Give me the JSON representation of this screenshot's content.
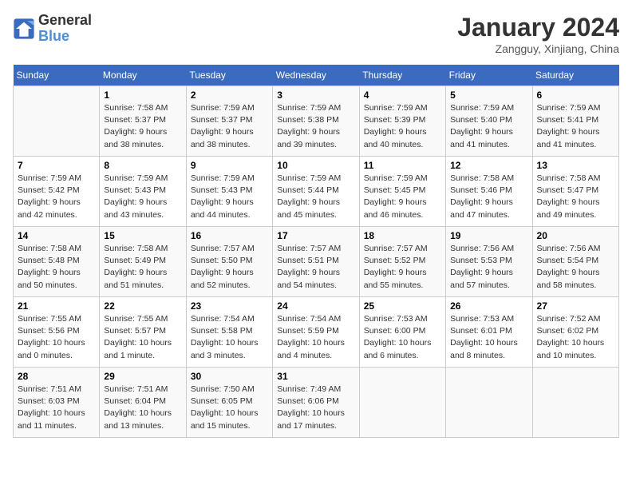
{
  "header": {
    "logo_line1": "General",
    "logo_line2": "Blue",
    "month": "January 2024",
    "location": "Zangguy, Xinjiang, China"
  },
  "weekdays": [
    "Sunday",
    "Monday",
    "Tuesday",
    "Wednesday",
    "Thursday",
    "Friday",
    "Saturday"
  ],
  "weeks": [
    [
      {
        "day": "",
        "info": ""
      },
      {
        "day": "1",
        "info": "Sunrise: 7:58 AM\nSunset: 5:37 PM\nDaylight: 9 hours\nand 38 minutes."
      },
      {
        "day": "2",
        "info": "Sunrise: 7:59 AM\nSunset: 5:37 PM\nDaylight: 9 hours\nand 38 minutes."
      },
      {
        "day": "3",
        "info": "Sunrise: 7:59 AM\nSunset: 5:38 PM\nDaylight: 9 hours\nand 39 minutes."
      },
      {
        "day": "4",
        "info": "Sunrise: 7:59 AM\nSunset: 5:39 PM\nDaylight: 9 hours\nand 40 minutes."
      },
      {
        "day": "5",
        "info": "Sunrise: 7:59 AM\nSunset: 5:40 PM\nDaylight: 9 hours\nand 41 minutes."
      },
      {
        "day": "6",
        "info": "Sunrise: 7:59 AM\nSunset: 5:41 PM\nDaylight: 9 hours\nand 41 minutes."
      }
    ],
    [
      {
        "day": "7",
        "info": "Sunrise: 7:59 AM\nSunset: 5:42 PM\nDaylight: 9 hours\nand 42 minutes."
      },
      {
        "day": "8",
        "info": "Sunrise: 7:59 AM\nSunset: 5:43 PM\nDaylight: 9 hours\nand 43 minutes."
      },
      {
        "day": "9",
        "info": "Sunrise: 7:59 AM\nSunset: 5:43 PM\nDaylight: 9 hours\nand 44 minutes."
      },
      {
        "day": "10",
        "info": "Sunrise: 7:59 AM\nSunset: 5:44 PM\nDaylight: 9 hours\nand 45 minutes."
      },
      {
        "day": "11",
        "info": "Sunrise: 7:59 AM\nSunset: 5:45 PM\nDaylight: 9 hours\nand 46 minutes."
      },
      {
        "day": "12",
        "info": "Sunrise: 7:58 AM\nSunset: 5:46 PM\nDaylight: 9 hours\nand 47 minutes."
      },
      {
        "day": "13",
        "info": "Sunrise: 7:58 AM\nSunset: 5:47 PM\nDaylight: 9 hours\nand 49 minutes."
      }
    ],
    [
      {
        "day": "14",
        "info": "Sunrise: 7:58 AM\nSunset: 5:48 PM\nDaylight: 9 hours\nand 50 minutes."
      },
      {
        "day": "15",
        "info": "Sunrise: 7:58 AM\nSunset: 5:49 PM\nDaylight: 9 hours\nand 51 minutes."
      },
      {
        "day": "16",
        "info": "Sunrise: 7:57 AM\nSunset: 5:50 PM\nDaylight: 9 hours\nand 52 minutes."
      },
      {
        "day": "17",
        "info": "Sunrise: 7:57 AM\nSunset: 5:51 PM\nDaylight: 9 hours\nand 54 minutes."
      },
      {
        "day": "18",
        "info": "Sunrise: 7:57 AM\nSunset: 5:52 PM\nDaylight: 9 hours\nand 55 minutes."
      },
      {
        "day": "19",
        "info": "Sunrise: 7:56 AM\nSunset: 5:53 PM\nDaylight: 9 hours\nand 57 minutes."
      },
      {
        "day": "20",
        "info": "Sunrise: 7:56 AM\nSunset: 5:54 PM\nDaylight: 9 hours\nand 58 minutes."
      }
    ],
    [
      {
        "day": "21",
        "info": "Sunrise: 7:55 AM\nSunset: 5:56 PM\nDaylight: 10 hours\nand 0 minutes."
      },
      {
        "day": "22",
        "info": "Sunrise: 7:55 AM\nSunset: 5:57 PM\nDaylight: 10 hours\nand 1 minute."
      },
      {
        "day": "23",
        "info": "Sunrise: 7:54 AM\nSunset: 5:58 PM\nDaylight: 10 hours\nand 3 minutes."
      },
      {
        "day": "24",
        "info": "Sunrise: 7:54 AM\nSunset: 5:59 PM\nDaylight: 10 hours\nand 4 minutes."
      },
      {
        "day": "25",
        "info": "Sunrise: 7:53 AM\nSunset: 6:00 PM\nDaylight: 10 hours\nand 6 minutes."
      },
      {
        "day": "26",
        "info": "Sunrise: 7:53 AM\nSunset: 6:01 PM\nDaylight: 10 hours\nand 8 minutes."
      },
      {
        "day": "27",
        "info": "Sunrise: 7:52 AM\nSunset: 6:02 PM\nDaylight: 10 hours\nand 10 minutes."
      }
    ],
    [
      {
        "day": "28",
        "info": "Sunrise: 7:51 AM\nSunset: 6:03 PM\nDaylight: 10 hours\nand 11 minutes."
      },
      {
        "day": "29",
        "info": "Sunrise: 7:51 AM\nSunset: 6:04 PM\nDaylight: 10 hours\nand 13 minutes."
      },
      {
        "day": "30",
        "info": "Sunrise: 7:50 AM\nSunset: 6:05 PM\nDaylight: 10 hours\nand 15 minutes."
      },
      {
        "day": "31",
        "info": "Sunrise: 7:49 AM\nSunset: 6:06 PM\nDaylight: 10 hours\nand 17 minutes."
      },
      {
        "day": "",
        "info": ""
      },
      {
        "day": "",
        "info": ""
      },
      {
        "day": "",
        "info": ""
      }
    ]
  ]
}
